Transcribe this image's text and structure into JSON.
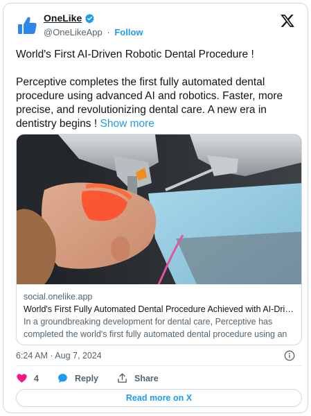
{
  "author": {
    "display_name": "OneLike",
    "handle": "@OneLikeApp",
    "separator": "·",
    "follow_label": "Follow"
  },
  "tweet": {
    "headline": "World's First AI-Driven Robotic Dental Procedure !",
    "body": "Perceptive completes the first fully automated dental procedure using advanced AI and robotics. Faster, more precise, and revolutionizing dental care. A new era in dentistry begins ! ",
    "show_more_label": "Show more"
  },
  "link_card": {
    "domain": "social.onelike.app",
    "title": "World's First Fully Automated Dental Procedure Achieved with AI-Driven…",
    "description": "In a groundbreaking development for dental care, Perceptive has completed the world's first fully automated dental procedure using an …"
  },
  "meta": {
    "timestamp": "6:24 AM · Aug 7, 2024"
  },
  "actions": {
    "like_count": "4",
    "reply_label": "Reply",
    "share_label": "Share"
  },
  "read_more_label": "Read more on X",
  "colors": {
    "accent": "#1d9bf0",
    "like": "#f91880",
    "text": "#0f1419",
    "muted": "#536471",
    "border": "#cfd9de"
  },
  "icons": [
    "thumbs-up-logo-icon",
    "verified-badge-icon",
    "x-logo-icon",
    "info-icon",
    "heart-icon",
    "reply-bubble-icon",
    "share-icon"
  ]
}
